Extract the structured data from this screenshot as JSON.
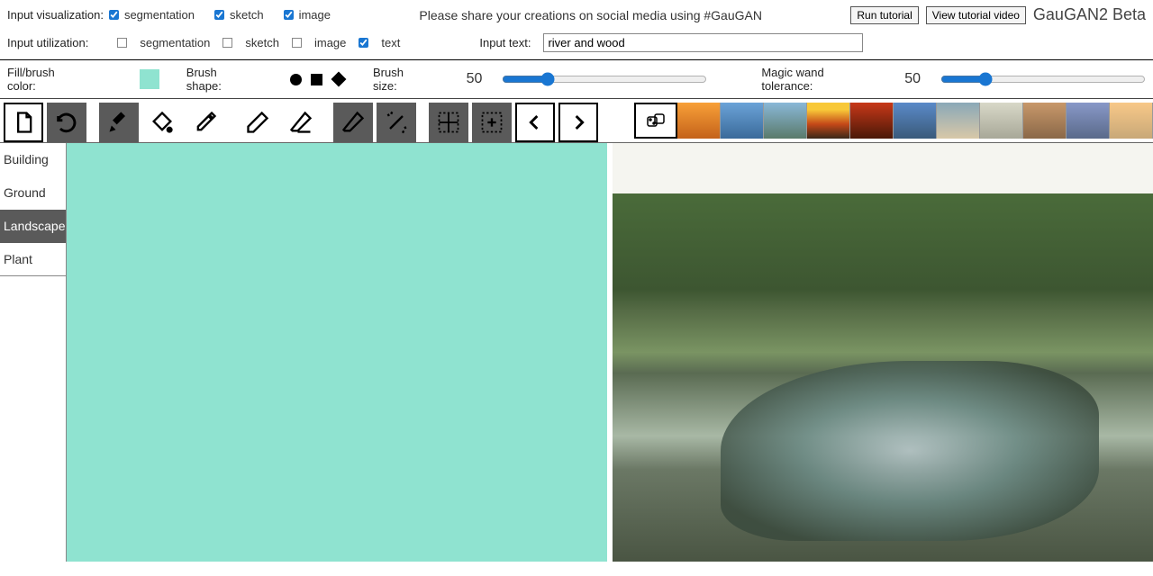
{
  "header": {
    "vis_label": "Input visualization:",
    "vis_seg": "segmentation",
    "vis_sketch": "sketch",
    "vis_image": "image",
    "tagline": "Please share your creations on social media using #GauGAN",
    "run_tutorial": "Run tutorial",
    "view_tutorial": "View tutorial video",
    "brand": "GauGAN2 Beta"
  },
  "util": {
    "label": "Input utilization:",
    "seg": "segmentation",
    "sketch": "sketch",
    "image": "image",
    "text": "text",
    "input_text_label": "Input text:",
    "input_text_value": "river and wood"
  },
  "toolbar": {
    "fill_label": "Fill/brush color:",
    "shape_label": "Brush shape:",
    "size_label": "Brush size:",
    "size_value": "50",
    "wand_label": "Magic wand tolerance:",
    "wand_value": "50"
  },
  "sidebar": {
    "items": [
      {
        "label": "Building"
      },
      {
        "label": "Ground"
      },
      {
        "label": "Landscape"
      },
      {
        "label": "Plant"
      }
    ],
    "active": 2
  },
  "colors": {
    "swatch": "#8fe3d0"
  }
}
